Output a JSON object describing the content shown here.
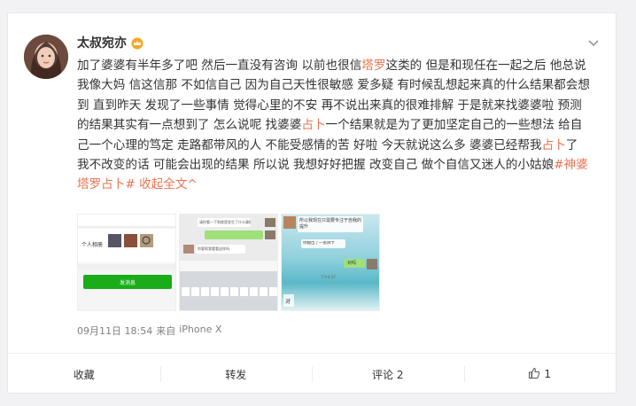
{
  "post": {
    "username": "太叔宛亦",
    "text": {
      "p1": "加了婆婆有半年多了吧 然后一直没有咨询 以前也很信",
      "tarot": "塔罗",
      "p2": "这类的 但是和现任在一起之后 他总说我像大妈 信这信那 不如信自己 因为自己天性很敏感 爱多疑 有时候乱想起来真的什么结果都会想到 直到昨天 发现了一些事情 觉得心里的不安 再不说出来真的很难排解 于是就来找婆婆啦 预测的结果其实有一点想到了 怎么说呢 找婆婆",
      "divination1": "占卜",
      "p3": "一个结果就是为了更加坚定自己的一些想法 给自己一个心理的笃定 走路都带风的人 不能受感情的苦 好啦 今天就说这么多 婆婆已经帮我",
      "divination2": "占卜",
      "p4": "了 我不改变的话 可能会出现的结果 所以说 我想好好把握 改变自己 做个自信又迷人的小姑娘",
      "hashtag": "#神婆塔罗占卜#",
      "collapse": "收起全文^"
    },
    "meta": {
      "date": "09月11日 18:54",
      "source_prefix": "来自",
      "device": "iPhone X"
    },
    "images": {
      "img1": {
        "label_personal": "个人相册",
        "send_button": "发消息"
      },
      "img2": {
        "bubble1": "请你看一下到底是发生了什么事情啊",
        "bubble2": "你要帮我看看这样吗",
        "kb_row": [
          "q",
          "w",
          "e",
          "r",
          "t",
          "y",
          "u",
          "i",
          "o",
          "p"
        ]
      },
      "img3": {
        "caption": "所以我现在只需要专注于自我的提升",
        "bubble": "你翻出了一张牌卡",
        "reply": "对吗",
        "time": "下午4:37",
        "ok": "对"
      }
    }
  },
  "actions": {
    "favorite": "收藏",
    "repost": "转发",
    "comment": "评论 2",
    "like_count": "1"
  },
  "colors": {
    "accent": "#eb7350",
    "wechat_green": "#1aad19"
  }
}
